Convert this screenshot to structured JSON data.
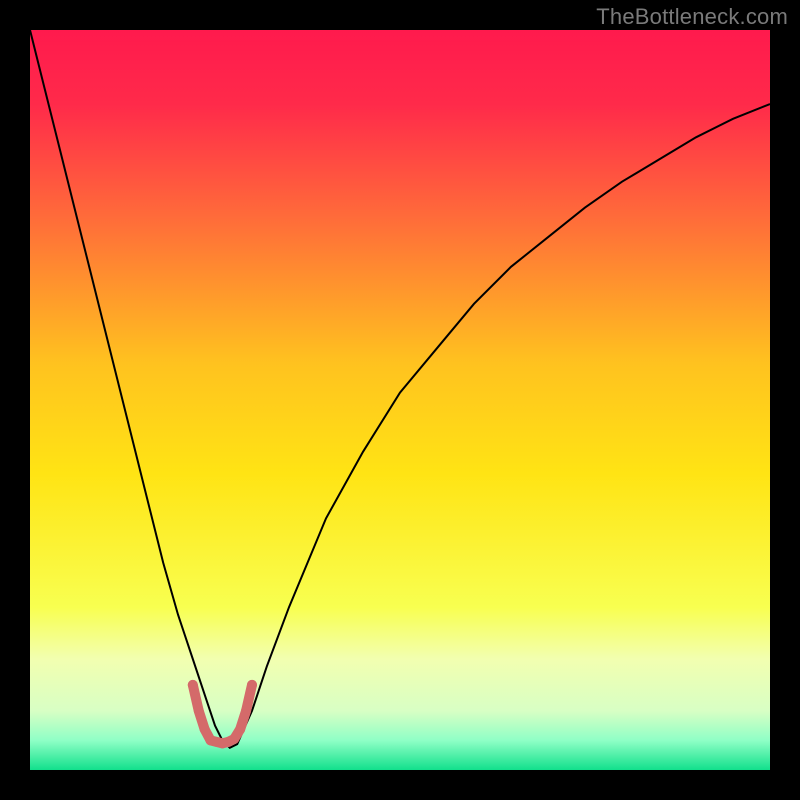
{
  "attribution": "TheBottleneck.com",
  "chart_data": {
    "type": "line",
    "title": "",
    "xlabel": "",
    "ylabel": "",
    "xlim": [
      0,
      100
    ],
    "ylim": [
      0,
      100
    ],
    "background_gradient_stops": [
      {
        "offset": 0.0,
        "color": "#ff1a4d"
      },
      {
        "offset": 0.1,
        "color": "#ff2a4a"
      },
      {
        "offset": 0.25,
        "color": "#ff6a3a"
      },
      {
        "offset": 0.45,
        "color": "#ffc21f"
      },
      {
        "offset": 0.6,
        "color": "#ffe414"
      },
      {
        "offset": 0.78,
        "color": "#f8ff50"
      },
      {
        "offset": 0.85,
        "color": "#f2ffb0"
      },
      {
        "offset": 0.92,
        "color": "#d8ffc4"
      },
      {
        "offset": 0.96,
        "color": "#8fffc6"
      },
      {
        "offset": 1.0,
        "color": "#12e08c"
      }
    ],
    "series": [
      {
        "name": "bottleneck-curve",
        "stroke": "#000000",
        "stroke_width": 2,
        "x": [
          0,
          2,
          4,
          6,
          8,
          10,
          12,
          14,
          16,
          18,
          20,
          22,
          24,
          25,
          26,
          27,
          28,
          30,
          32,
          35,
          40,
          45,
          50,
          55,
          60,
          65,
          70,
          75,
          80,
          85,
          90,
          95,
          100
        ],
        "y": [
          100,
          92,
          84,
          76,
          68,
          60,
          52,
          44,
          36,
          28,
          21,
          15,
          9,
          6,
          4,
          3,
          3.5,
          8,
          14,
          22,
          34,
          43,
          51,
          57,
          63,
          68,
          72,
          76,
          79.5,
          82.5,
          85.5,
          88,
          90
        ]
      },
      {
        "name": "good-range-marker",
        "stroke": "#d46a6a",
        "stroke_width": 10,
        "stroke_linecap": "round",
        "x": [
          22.0,
          22.8,
          23.6,
          24.4,
          25.2,
          26.0,
          26.8,
          27.6,
          28.4,
          29.2,
          30.0
        ],
        "y": [
          11.5,
          8.0,
          5.5,
          4.0,
          3.8,
          3.6,
          3.8,
          4.2,
          5.5,
          8.0,
          11.5
        ]
      }
    ]
  }
}
